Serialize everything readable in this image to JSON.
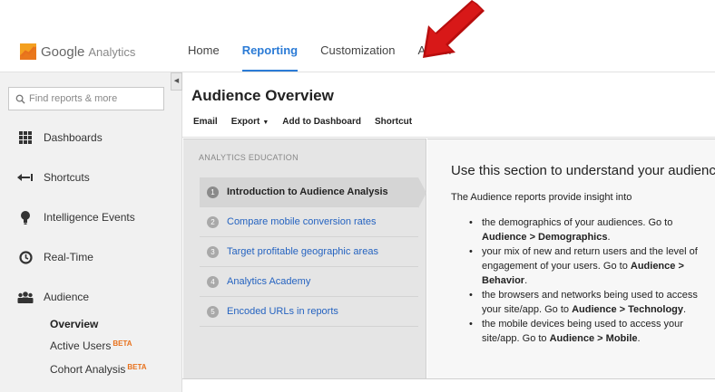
{
  "brand": {
    "google": "Google",
    "analytics": "Analytics",
    "colors": {
      "accent": "#2b7bd6",
      "logo_orange": "#f4a020",
      "logo_red": "#e8711c",
      "arrow": "#cc1111"
    }
  },
  "topnav": {
    "items": [
      {
        "label": "Home",
        "active": false
      },
      {
        "label": "Reporting",
        "active": true
      },
      {
        "label": "Customization",
        "active": false
      },
      {
        "label": "Admin",
        "active": false
      }
    ]
  },
  "sidebar": {
    "search": {
      "placeholder": "Find reports & more",
      "icon": "search-icon"
    },
    "items": [
      {
        "label": "Dashboards",
        "icon": "grid-icon"
      },
      {
        "label": "Shortcuts",
        "icon": "shortcut-arrow-icon"
      },
      {
        "label": "Intelligence Events",
        "icon": "lightbulb-icon"
      },
      {
        "label": "Real-Time",
        "icon": "clock-icon"
      },
      {
        "label": "Audience",
        "icon": "people-icon"
      }
    ],
    "sub_items": [
      {
        "label": "Overview",
        "beta": ""
      },
      {
        "label": "Active Users",
        "beta": "BETA"
      },
      {
        "label": "Cohort Analysis",
        "beta": "BETA"
      }
    ]
  },
  "page": {
    "title": "Audience Overview",
    "toolbar": {
      "email": "Email",
      "export": "Export",
      "add_to_dashboard": "Add to Dashboard",
      "shortcut": "Shortcut"
    }
  },
  "education": {
    "heading": "ANALYTICS EDUCATION",
    "items": [
      {
        "num": "1",
        "label": "Introduction to Audience Analysis",
        "active": true
      },
      {
        "num": "2",
        "label": "Compare mobile conversion rates",
        "active": false
      },
      {
        "num": "3",
        "label": "Target profitable geographic areas",
        "active": false
      },
      {
        "num": "4",
        "label": "Analytics Academy",
        "active": false
      },
      {
        "num": "5",
        "label": "Encoded URLs in reports",
        "active": false
      }
    ],
    "content": {
      "title": "Use this section to understand your audience",
      "intro": "The Audience reports provide insight into",
      "bullets": [
        {
          "text": "the demographics of your audiences. Go to ",
          "bold": "Audience > Demographics",
          "tail": "."
        },
        {
          "text": "your mix of new and return users and the level of engagement of your users. Go to ",
          "bold": "Audience > Behavior",
          "tail": "."
        },
        {
          "text": "the browsers and networks being used to access your site/app. Go to ",
          "bold": "Audience > Technology",
          "tail": "."
        },
        {
          "text": "the mobile devices being used to access your site/app. Go to ",
          "bold": "Audience > Mobile",
          "tail": "."
        }
      ]
    }
  }
}
